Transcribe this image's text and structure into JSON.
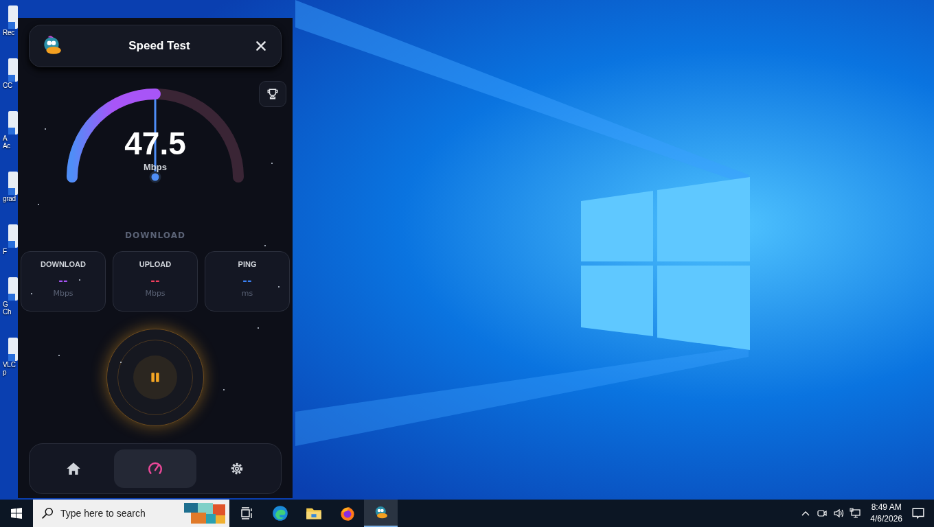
{
  "desktop_icons": [
    {
      "lines": [
        "Rec"
      ]
    },
    {
      "lines": [
        "CC"
      ]
    },
    {
      "lines": [
        "A",
        "Ac"
      ]
    },
    {
      "lines": [
        "grad"
      ]
    },
    {
      "lines": [
        "F"
      ]
    },
    {
      "lines": [
        "G",
        "Ch"
      ]
    },
    {
      "lines": [
        "VLC",
        "p"
      ]
    }
  ],
  "app": {
    "title": "Speed Test",
    "gauge": {
      "value": "47.5",
      "unit": "Mbps",
      "level": 0.5
    },
    "phase": "DOWNLOAD",
    "stats": [
      {
        "label": "DOWNLOAD",
        "value": "--",
        "unit": "Mbps",
        "color": "#a855f7"
      },
      {
        "label": "UPLOAD",
        "value": "--",
        "unit": "Mbps",
        "color": "#f43f5e"
      },
      {
        "label": "PING",
        "value": "--",
        "unit": "ms",
        "color": "#3b82f6"
      }
    ],
    "nav": [
      {
        "kind": "home",
        "selected": false
      },
      {
        "kind": "gauge",
        "selected": true
      },
      {
        "kind": "settings",
        "selected": false
      }
    ]
  },
  "taskbar": {
    "search": {
      "placeholder": "Type here to search"
    },
    "apps": [
      {
        "kind": "taskview",
        "selected": false
      },
      {
        "kind": "edge",
        "selected": false
      },
      {
        "kind": "folder",
        "selected": false
      },
      {
        "kind": "firefox",
        "selected": false
      },
      {
        "kind": "duck",
        "selected": true
      }
    ],
    "time": "8:49 AM",
    "date": "4/6/2026"
  }
}
